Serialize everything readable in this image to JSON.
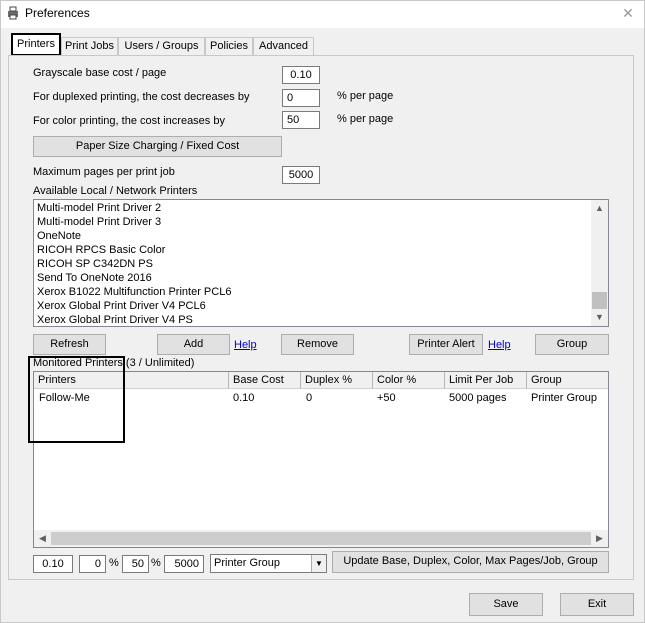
{
  "window": {
    "title": "Preferences",
    "app_icon": "printer-icon",
    "close_glyph": "✕"
  },
  "tabs": [
    {
      "label": "Printers",
      "active": true
    },
    {
      "label": "Print Jobs",
      "active": false
    },
    {
      "label": "Users / Groups",
      "active": false
    },
    {
      "label": "Policies",
      "active": false
    },
    {
      "label": "Advanced",
      "active": false
    }
  ],
  "settings": {
    "grayscale_label": "Grayscale base cost / page",
    "grayscale_value": "0.10",
    "duplex_label": "For duplexed printing, the cost decreases by",
    "duplex_value": "0",
    "duplex_unit": "% per page",
    "color_label": "For color printing, the cost increases by",
    "color_value": "50",
    "color_unit": "% per page",
    "paper_size_button": "Paper Size Charging / Fixed Cost",
    "max_pages_label": "Maximum pages per print job",
    "max_pages_value": "5000"
  },
  "available": {
    "label": "Available Local / Network Printers",
    "printers": [
      "Multi-model Print Driver 2",
      "Multi-model Print Driver 3",
      "OneNote",
      "RICOH RPCS Basic Color",
      "RICOH SP C342DN PS",
      "Send To OneNote 2016",
      "Xerox B1022 Multifunction Printer PCL6",
      "Xerox Global Print Driver V4 PCL6",
      "Xerox Global Print Driver V4 PS"
    ],
    "scroll_up": "▲",
    "scroll_down": "▼",
    "scroll_position": 0.92
  },
  "buttons": {
    "refresh": "Refresh",
    "add": "Add",
    "help1": "Help",
    "remove": "Remove",
    "printer_alert": "Printer Alert",
    "help2": "Help",
    "group": "Group"
  },
  "monitored": {
    "label": "Monitored Printers (3 / Unlimited)",
    "columns": [
      "Printers",
      "Base Cost",
      "Duplex %",
      "Color %",
      "Limit Per Job",
      "Group"
    ],
    "rows": [
      [
        "Follow-Me",
        "0.10",
        "0",
        "+50",
        "5000 pages",
        "Printer Group"
      ]
    ],
    "scroll_left": "◀",
    "scroll_right": "▶"
  },
  "editor": {
    "base_cost": "0.10",
    "duplex": "0",
    "duplex_symbol": "%",
    "color": "50",
    "color_symbol": "%",
    "max_pages": "5000",
    "group_select": "Printer Group",
    "dropdown_glyph": "▼",
    "update_button": "Update Base, Duplex, Color, Max Pages/Job, Group"
  },
  "footer": {
    "save": "Save",
    "exit": "Exit"
  }
}
